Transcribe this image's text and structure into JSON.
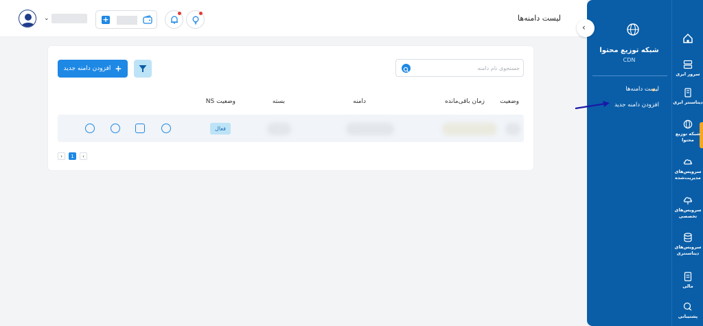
{
  "header": {
    "page_title": "لیست دامنه‌ها",
    "notification_icon": "bell-icon",
    "tips_icon": "lightbulb-icon",
    "wallet_icon": "wallet-icon"
  },
  "card": {
    "add_button_label": "افزودن دامنه جدید",
    "search_placeholder": "جستجوی نام دامنه",
    "columns": [
      "وضعیت",
      "زمان باقی‌مانده",
      "دامنه",
      "بسته",
      "وضعیت NS"
    ],
    "row": {
      "ns_status": "فعال"
    },
    "pagination": {
      "current_page": "1"
    }
  },
  "sub_sidebar": {
    "title": "شبکه توزیع محتوا",
    "subtitle": "CDN",
    "items": [
      "لیست دامنه‌ها",
      "افزودن دامنه جدید"
    ]
  },
  "main_sidebar": {
    "items": [
      {
        "label": ""
      },
      {
        "label": "سرور ابری"
      },
      {
        "label": "دیتاسنتر ابری"
      },
      {
        "label": "شبکه توزیع محتوا"
      },
      {
        "label": "سرویس‌های مدیریت‌شده"
      },
      {
        "label": "سرویس‌های تخصصی"
      },
      {
        "label": "سرویس‌های دیتاسنتری"
      },
      {
        "label": "مالی"
      },
      {
        "label": "پشتیبانی"
      }
    ]
  },
  "colors": {
    "primary": "#1e88e5",
    "sidebar": "#0a5ea8",
    "accent": "#f5a623",
    "badge_bg": "#bde3f7"
  }
}
